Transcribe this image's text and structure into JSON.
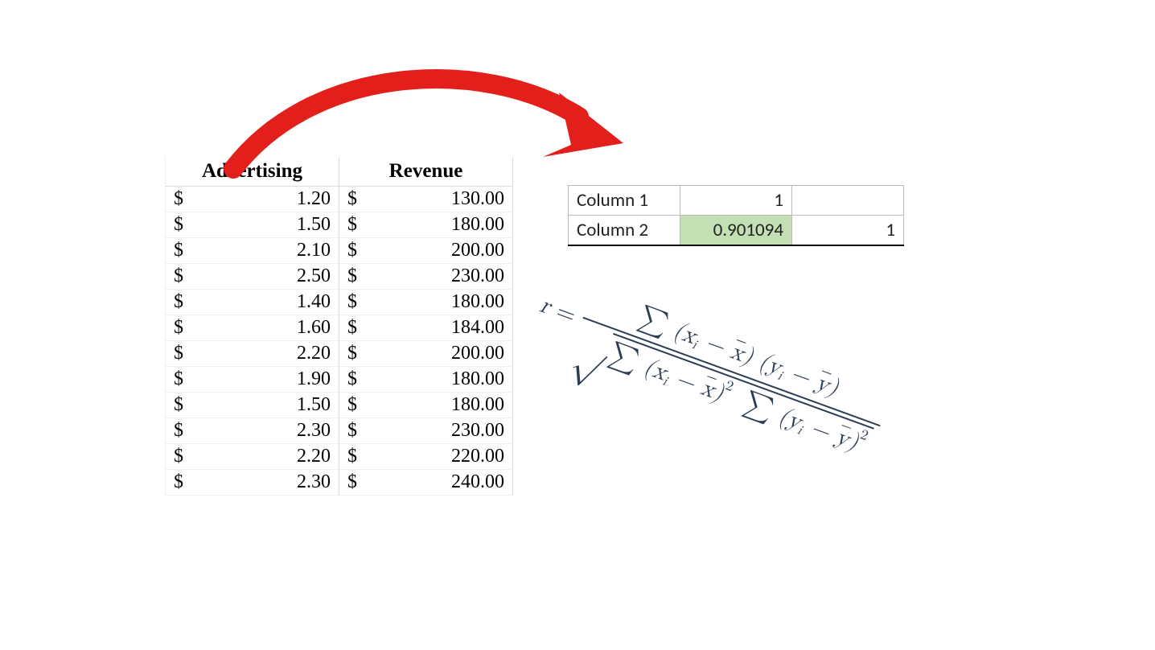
{
  "data_table": {
    "headers": [
      "Advertising",
      "Revenue"
    ],
    "currency_symbol": "$",
    "rows": [
      {
        "advertising": "1.20",
        "revenue": "130.00"
      },
      {
        "advertising": "1.50",
        "revenue": "180.00"
      },
      {
        "advertising": "2.10",
        "revenue": "200.00"
      },
      {
        "advertising": "2.50",
        "revenue": "230.00"
      },
      {
        "advertising": "1.40",
        "revenue": "180.00"
      },
      {
        "advertising": "1.60",
        "revenue": "184.00"
      },
      {
        "advertising": "2.20",
        "revenue": "200.00"
      },
      {
        "advertising": "1.90",
        "revenue": "180.00"
      },
      {
        "advertising": "1.50",
        "revenue": "180.00"
      },
      {
        "advertising": "2.30",
        "revenue": "230.00"
      },
      {
        "advertising": "2.20",
        "revenue": "220.00"
      },
      {
        "advertising": "2.30",
        "revenue": "240.00"
      }
    ]
  },
  "corr_matrix": {
    "row1_label": "Column 1",
    "row1_v1": "1",
    "row1_v2": "",
    "row2_label": "Column 2",
    "row2_v1": "0.901094",
    "row2_v2": "1",
    "highlight_color": "#c3dfb4"
  },
  "arrow": {
    "color": "#e21f1a"
  },
  "formula": {
    "lhs": "r",
    "eq": "=",
    "numerator_parts": {
      "sigma": "∑",
      "open": "(",
      "close": ")",
      "xi": "x",
      "i": "i",
      "minus": " − ",
      "xbar": "x",
      "yi": "y",
      "ybar": "y"
    },
    "exp2": "2",
    "radical": "√"
  }
}
